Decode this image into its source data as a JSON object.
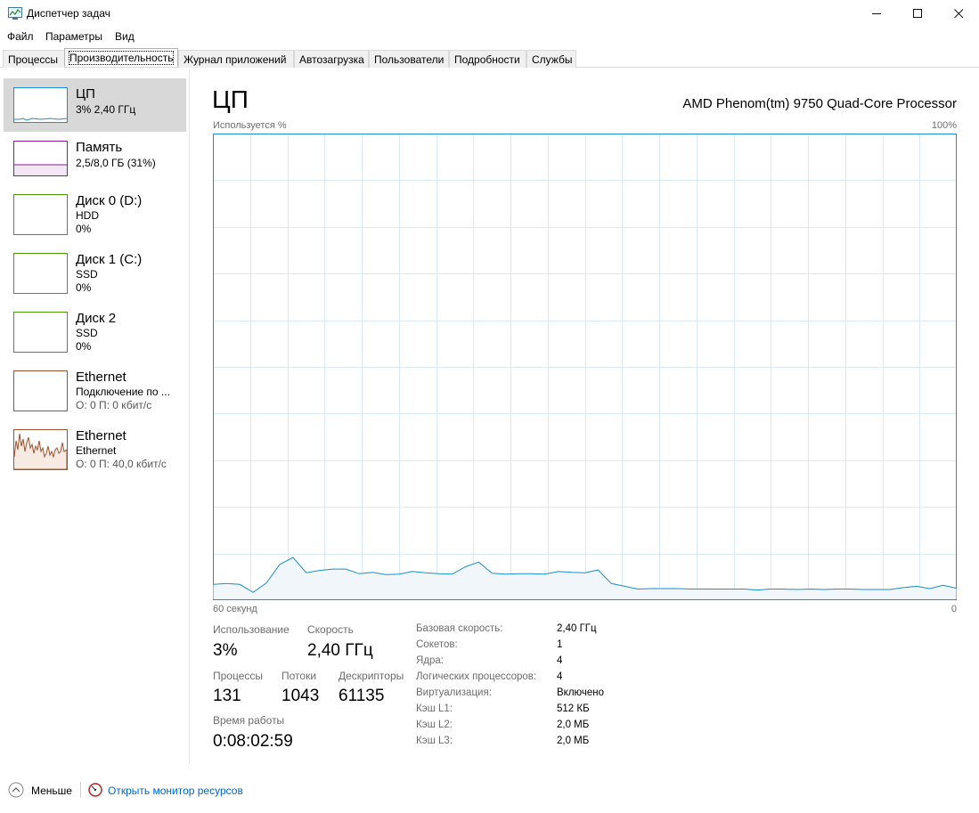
{
  "window": {
    "title": "Диспетчер задач",
    "minimize_glyph": "─",
    "maximize_glyph": "☐",
    "close_glyph": "✕"
  },
  "menu": [
    {
      "label": "Файл"
    },
    {
      "label": "Параметры"
    },
    {
      "label": "Вид"
    }
  ],
  "tabs": [
    {
      "label": "Процессы"
    },
    {
      "label": "Производительность"
    },
    {
      "label": "Журнал приложений"
    },
    {
      "label": "Автозагрузка"
    },
    {
      "label": "Пользователи"
    },
    {
      "label": "Подробности"
    },
    {
      "label": "Службы"
    }
  ],
  "sidebar": [
    {
      "name": "ЦП",
      "line1": "3% 2,40 ГГц",
      "line2": "",
      "color": "#1a8fd1"
    },
    {
      "name": "Память",
      "line1": "2,5/8,0 ГБ (31%)",
      "line2": "",
      "color": "#8b1a9a"
    },
    {
      "name": "Диск 0 (D:)",
      "line1": "HDD",
      "line2": "0%",
      "color": "#4e9a06"
    },
    {
      "name": "Диск 1 (C:)",
      "line1": "SSD",
      "line2": "0%",
      "color": "#4e9a06"
    },
    {
      "name": "Диск 2",
      "line1": "SSD",
      "line2": "0%",
      "color": "#4e9a06"
    },
    {
      "name": "Ethernet",
      "line1": "Подключение по ...",
      "line2": "О: 0 П: 0 кбит/с",
      "color": "#a0522d"
    },
    {
      "name": "Ethernet",
      "line1": "Ethernet",
      "line2": "О: 0 П: 40,0 кбит/с",
      "color": "#a0522d"
    }
  ],
  "main": {
    "title": "ЦП",
    "processor": "AMD Phenom(tm) 9750 Quad-Core Processor",
    "usage_label": "Используется %",
    "max_label": "100%",
    "time_left": "60 секунд",
    "time_right": "0"
  },
  "stats": {
    "usage_label": "Использование",
    "usage_value": "3%",
    "speed_label": "Скорость",
    "speed_value": "2,40 ГГц",
    "processes_label": "Процессы",
    "processes_value": "131",
    "threads_label": "Потоки",
    "threads_value": "1043",
    "handles_label": "Дескрипторы",
    "handles_value": "61135",
    "uptime_label": "Время работы",
    "uptime_value": "0:08:02:59"
  },
  "info": [
    {
      "label": "Базовая скорость:",
      "value": "2,40 ГГц"
    },
    {
      "label": "Сокетов:",
      "value": "1"
    },
    {
      "label": "Ядра:",
      "value": "4"
    },
    {
      "label": "Логических процессоров:",
      "value": "4"
    },
    {
      "label": "Виртуализация:",
      "value": "Включено"
    },
    {
      "label": "Кэш L1:",
      "value": "512 КБ"
    },
    {
      "label": "Кэш L2:",
      "value": "2,0 МБ"
    },
    {
      "label": "Кэш L3:",
      "value": "2,0 МБ"
    }
  ],
  "bottom": {
    "fewer_label": "Меньше",
    "monitor_label": "Открыть монитор ресурсов"
  },
  "colors": {
    "cpu_line": "#1a8fd1",
    "cpu_fill": "#f1f6fa",
    "grid": "#d9eaf5",
    "ethernet_line": "#a0522d"
  },
  "cpu_history_percent": [
    3.2,
    3.4,
    3.2,
    1.5,
    3.5,
    7.5,
    9.0,
    5.7,
    6.2,
    6.5,
    6.5,
    5.5,
    5.8,
    5.3,
    5.4,
    6.0,
    5.7,
    5.5,
    5.4,
    7.0,
    8.0,
    5.6,
    5.4,
    5.5,
    5.5,
    5.4,
    6.0,
    5.8,
    5.7,
    6.3,
    3.4,
    2.8,
    2.2,
    2.3,
    2.3,
    2.3,
    2.2,
    2.2,
    2.2,
    2.2,
    2.2,
    2.0,
    2.2,
    2.2,
    2.1,
    2.2,
    2.1,
    2.2,
    2.2,
    2.1,
    2.1,
    2.1,
    2.5,
    2.8,
    2.3,
    3.0,
    2.4
  ]
}
